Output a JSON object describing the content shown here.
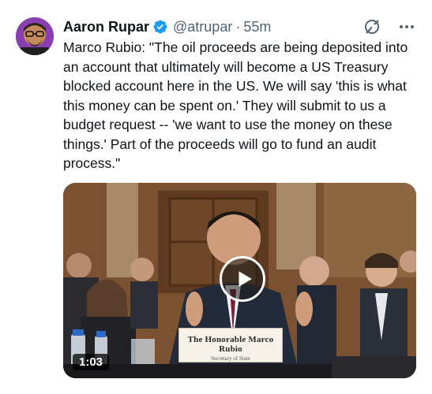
{
  "author": {
    "name": "Aaron Rupar",
    "handle": "@atrupar",
    "separator": "·",
    "time": "55m",
    "verified_color": "#1d9bf0"
  },
  "icons": {
    "grok": "grok-icon",
    "more": "more-icon",
    "play": "play-icon"
  },
  "tweet": {
    "text": "Marco Rubio: \"The oil proceeds are being deposited into an account that ultimately will become a US Treasury blocked account here in the US. We will say 'this is what this money can be spent on.' They will submit to us a budget request -- 'we want to use the money on these things.' Part of the proceeds will go to fund an audit process.\""
  },
  "media": {
    "duration": "1:03",
    "nameplate_title": "The Honorable Marco Rubio",
    "nameplate_subtitle": "Secretary of State"
  },
  "colors": {
    "text_primary": "#0f1419",
    "text_secondary": "#536471",
    "accent": "#1d9bf0"
  }
}
